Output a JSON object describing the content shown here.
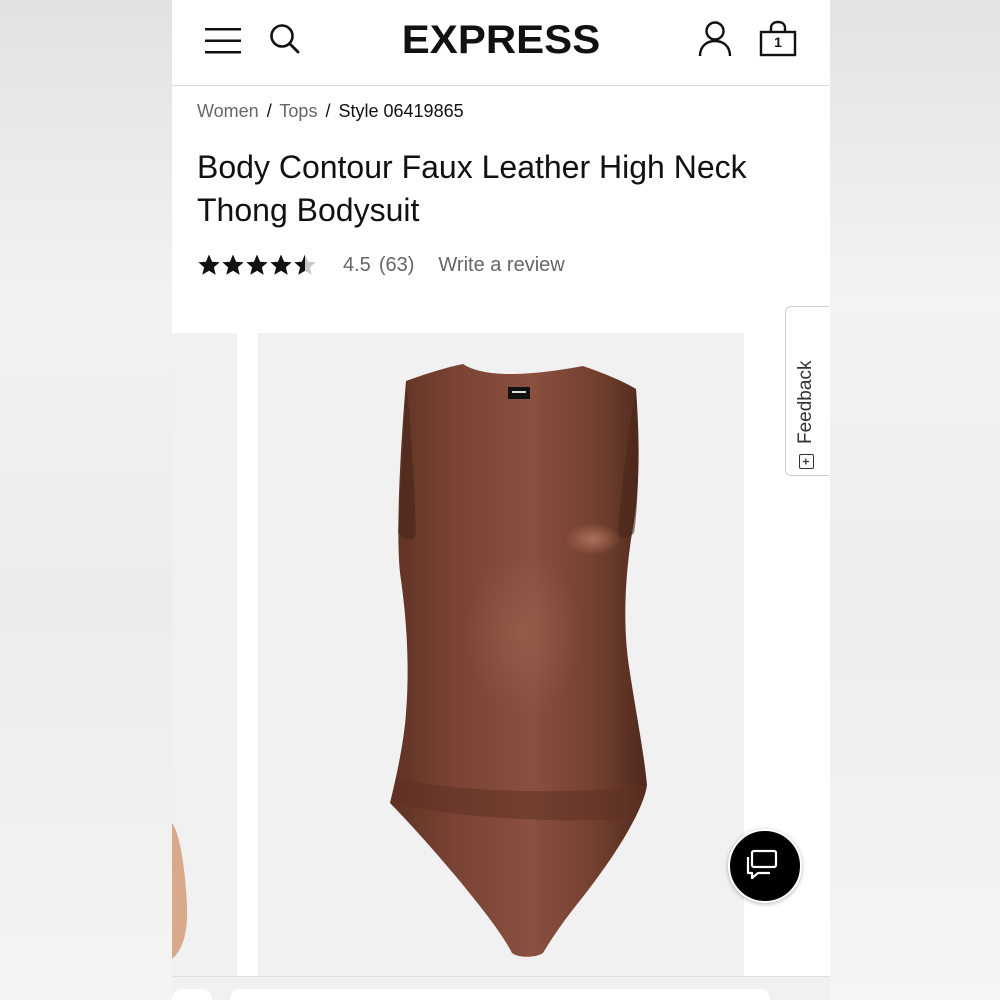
{
  "header": {
    "logo": "EXPRESS",
    "bag_count": "1",
    "icons": [
      "menu-icon",
      "search-icon",
      "account-icon",
      "shopping-bag-icon"
    ]
  },
  "breadcrumb": {
    "items": [
      "Women",
      "Tops"
    ],
    "separator": "/",
    "current": "Style 06419865"
  },
  "product": {
    "title": "Body Contour Faux Leather High Neck Thong Bodysuit",
    "rating": 4.5,
    "rating_display": "4.5",
    "review_count": "(63)",
    "write_review": "Write a review",
    "color_swatch": "#7a4534"
  },
  "feedback": {
    "label": "Feedback",
    "icon": "plus-box-icon"
  },
  "chat": {
    "icon": "chat-bubbles-icon"
  },
  "colors": {
    "accent": "#000000",
    "text": "#111111",
    "muted": "#666666",
    "image_bg": "#f2f1f1"
  }
}
